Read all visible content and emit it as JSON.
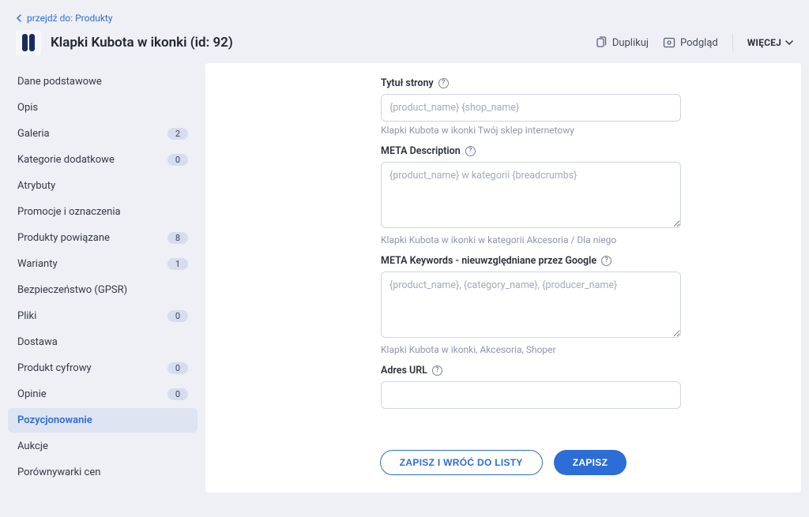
{
  "breadcrumb": {
    "label": "przejdź do: Produkty"
  },
  "product": {
    "title": "Klapki Kubota w ikonki (id: 92)"
  },
  "top_actions": {
    "duplicate": "Duplikuj",
    "preview": "Podgląd",
    "more": "WIĘCEJ"
  },
  "sidebar": {
    "items": [
      {
        "label": "Dane podstawowe",
        "badge": null
      },
      {
        "label": "Opis",
        "badge": null
      },
      {
        "label": "Galeria",
        "badge": "2"
      },
      {
        "label": "Kategorie dodatkowe",
        "badge": "0"
      },
      {
        "label": "Atrybuty",
        "badge": null
      },
      {
        "label": "Promocje i oznaczenia",
        "badge": null
      },
      {
        "label": "Produkty powiązane",
        "badge": "8"
      },
      {
        "label": "Warianty",
        "badge": "1"
      },
      {
        "label": "Bezpieczeństwo (GPSR)",
        "badge": null
      },
      {
        "label": "Pliki",
        "badge": "0"
      },
      {
        "label": "Dostawa",
        "badge": null
      },
      {
        "label": "Produkt cyfrowy",
        "badge": "0"
      },
      {
        "label": "Opinie",
        "badge": "0"
      },
      {
        "label": "Pozycjonowanie",
        "badge": null
      },
      {
        "label": "Aukcje",
        "badge": null
      },
      {
        "label": "Porównywarki cen",
        "badge": null
      }
    ]
  },
  "form": {
    "page_title": {
      "label": "Tytuł strony",
      "placeholder": "{product_name} {shop_name}",
      "hint": "Klapki Kubota w ikonki Twój sklep internetowy"
    },
    "meta_description": {
      "label": "META Description",
      "placeholder": "{product_name} w kategorii {breadcrumbs}",
      "hint": "Klapki Kubota w ikonki w kategorii Akcesoria / Dla niego"
    },
    "meta_keywords": {
      "label": "META Keywords - nieuwzględniane przez Google",
      "placeholder": "{product_name}, {category_name}, {producer_name}",
      "hint": "Klapki Kubota w ikonki, Akcesoria, Shoper"
    },
    "url": {
      "label": "Adres URL"
    }
  },
  "buttons": {
    "save_back": "ZAPISZ I WRÓĆ DO LISTY",
    "save": "ZAPISZ"
  }
}
